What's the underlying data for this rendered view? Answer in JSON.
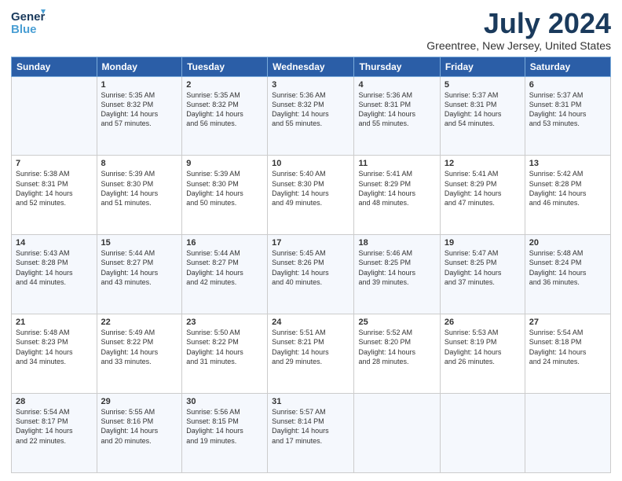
{
  "header": {
    "logo_general": "General",
    "logo_blue": "Blue",
    "main_title": "July 2024",
    "subtitle": "Greentree, New Jersey, United States"
  },
  "days_of_week": [
    "Sunday",
    "Monday",
    "Tuesday",
    "Wednesday",
    "Thursday",
    "Friday",
    "Saturday"
  ],
  "weeks": [
    [
      {
        "day": "",
        "info": ""
      },
      {
        "day": "1",
        "info": "Sunrise: 5:35 AM\nSunset: 8:32 PM\nDaylight: 14 hours\nand 57 minutes."
      },
      {
        "day": "2",
        "info": "Sunrise: 5:35 AM\nSunset: 8:32 PM\nDaylight: 14 hours\nand 56 minutes."
      },
      {
        "day": "3",
        "info": "Sunrise: 5:36 AM\nSunset: 8:32 PM\nDaylight: 14 hours\nand 55 minutes."
      },
      {
        "day": "4",
        "info": "Sunrise: 5:36 AM\nSunset: 8:31 PM\nDaylight: 14 hours\nand 55 minutes."
      },
      {
        "day": "5",
        "info": "Sunrise: 5:37 AM\nSunset: 8:31 PM\nDaylight: 14 hours\nand 54 minutes."
      },
      {
        "day": "6",
        "info": "Sunrise: 5:37 AM\nSunset: 8:31 PM\nDaylight: 14 hours\nand 53 minutes."
      }
    ],
    [
      {
        "day": "7",
        "info": "Sunrise: 5:38 AM\nSunset: 8:31 PM\nDaylight: 14 hours\nand 52 minutes."
      },
      {
        "day": "8",
        "info": "Sunrise: 5:39 AM\nSunset: 8:30 PM\nDaylight: 14 hours\nand 51 minutes."
      },
      {
        "day": "9",
        "info": "Sunrise: 5:39 AM\nSunset: 8:30 PM\nDaylight: 14 hours\nand 50 minutes."
      },
      {
        "day": "10",
        "info": "Sunrise: 5:40 AM\nSunset: 8:30 PM\nDaylight: 14 hours\nand 49 minutes."
      },
      {
        "day": "11",
        "info": "Sunrise: 5:41 AM\nSunset: 8:29 PM\nDaylight: 14 hours\nand 48 minutes."
      },
      {
        "day": "12",
        "info": "Sunrise: 5:41 AM\nSunset: 8:29 PM\nDaylight: 14 hours\nand 47 minutes."
      },
      {
        "day": "13",
        "info": "Sunrise: 5:42 AM\nSunset: 8:28 PM\nDaylight: 14 hours\nand 46 minutes."
      }
    ],
    [
      {
        "day": "14",
        "info": "Sunrise: 5:43 AM\nSunset: 8:28 PM\nDaylight: 14 hours\nand 44 minutes."
      },
      {
        "day": "15",
        "info": "Sunrise: 5:44 AM\nSunset: 8:27 PM\nDaylight: 14 hours\nand 43 minutes."
      },
      {
        "day": "16",
        "info": "Sunrise: 5:44 AM\nSunset: 8:27 PM\nDaylight: 14 hours\nand 42 minutes."
      },
      {
        "day": "17",
        "info": "Sunrise: 5:45 AM\nSunset: 8:26 PM\nDaylight: 14 hours\nand 40 minutes."
      },
      {
        "day": "18",
        "info": "Sunrise: 5:46 AM\nSunset: 8:25 PM\nDaylight: 14 hours\nand 39 minutes."
      },
      {
        "day": "19",
        "info": "Sunrise: 5:47 AM\nSunset: 8:25 PM\nDaylight: 14 hours\nand 37 minutes."
      },
      {
        "day": "20",
        "info": "Sunrise: 5:48 AM\nSunset: 8:24 PM\nDaylight: 14 hours\nand 36 minutes."
      }
    ],
    [
      {
        "day": "21",
        "info": "Sunrise: 5:48 AM\nSunset: 8:23 PM\nDaylight: 14 hours\nand 34 minutes."
      },
      {
        "day": "22",
        "info": "Sunrise: 5:49 AM\nSunset: 8:22 PM\nDaylight: 14 hours\nand 33 minutes."
      },
      {
        "day": "23",
        "info": "Sunrise: 5:50 AM\nSunset: 8:22 PM\nDaylight: 14 hours\nand 31 minutes."
      },
      {
        "day": "24",
        "info": "Sunrise: 5:51 AM\nSunset: 8:21 PM\nDaylight: 14 hours\nand 29 minutes."
      },
      {
        "day": "25",
        "info": "Sunrise: 5:52 AM\nSunset: 8:20 PM\nDaylight: 14 hours\nand 28 minutes."
      },
      {
        "day": "26",
        "info": "Sunrise: 5:53 AM\nSunset: 8:19 PM\nDaylight: 14 hours\nand 26 minutes."
      },
      {
        "day": "27",
        "info": "Sunrise: 5:54 AM\nSunset: 8:18 PM\nDaylight: 14 hours\nand 24 minutes."
      }
    ],
    [
      {
        "day": "28",
        "info": "Sunrise: 5:54 AM\nSunset: 8:17 PM\nDaylight: 14 hours\nand 22 minutes."
      },
      {
        "day": "29",
        "info": "Sunrise: 5:55 AM\nSunset: 8:16 PM\nDaylight: 14 hours\nand 20 minutes."
      },
      {
        "day": "30",
        "info": "Sunrise: 5:56 AM\nSunset: 8:15 PM\nDaylight: 14 hours\nand 19 minutes."
      },
      {
        "day": "31",
        "info": "Sunrise: 5:57 AM\nSunset: 8:14 PM\nDaylight: 14 hours\nand 17 minutes."
      },
      {
        "day": "",
        "info": ""
      },
      {
        "day": "",
        "info": ""
      },
      {
        "day": "",
        "info": ""
      }
    ]
  ]
}
